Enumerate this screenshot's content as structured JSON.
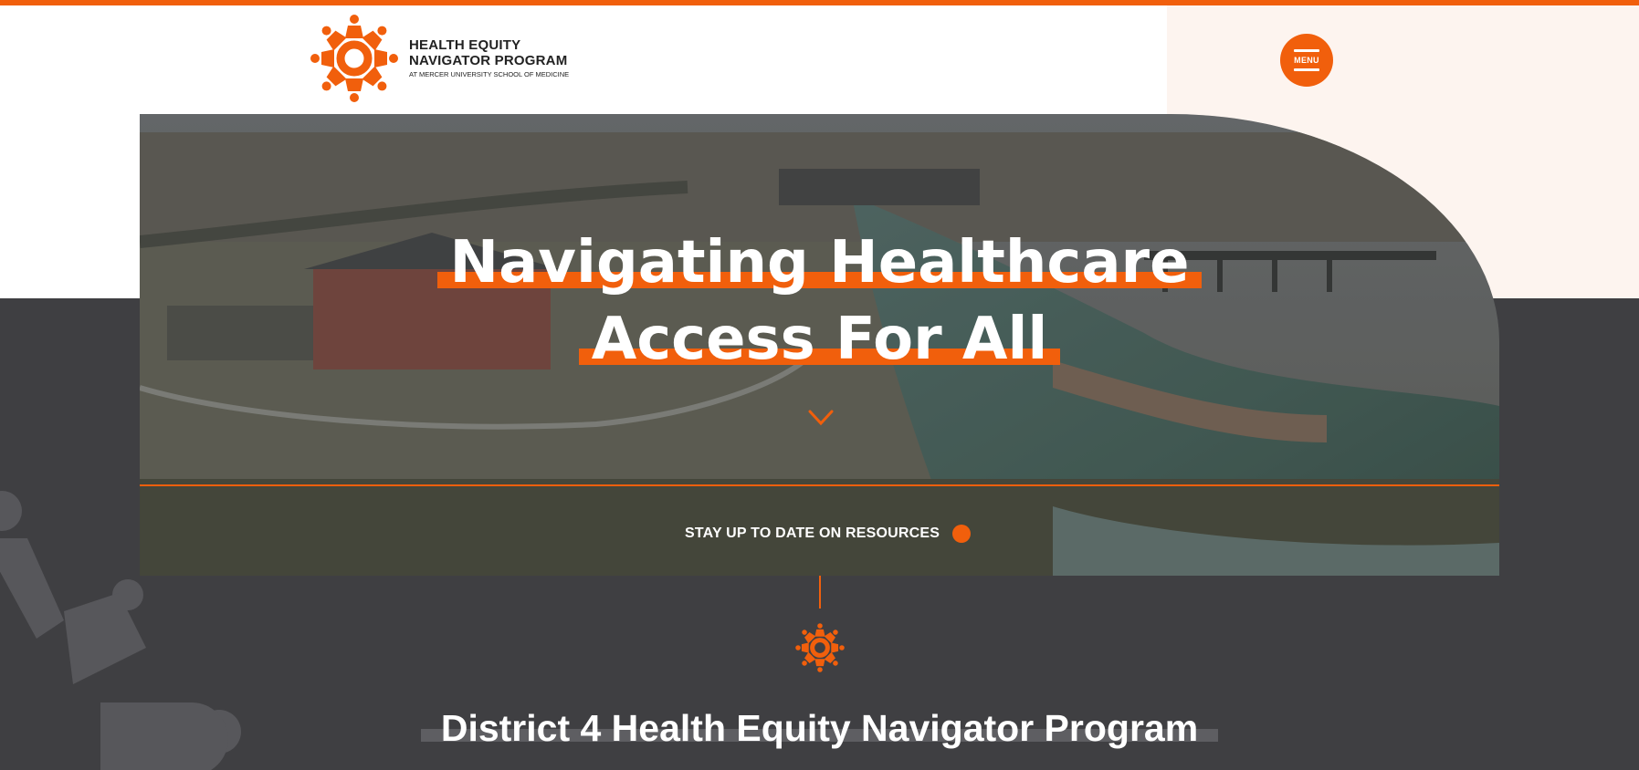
{
  "brand": {
    "name_line1": "HEALTH EQUITY",
    "name_line2": "NAVIGATOR PROGRAM",
    "tagline": "AT MERCER UNIVERSITY SCHOOL OF MEDICINE",
    "accent_color": "#f15f0c",
    "dark_color": "#3f3f42",
    "cream_color": "#fdf4ef"
  },
  "header": {
    "menu_label": "MENU"
  },
  "hero": {
    "title_line1": "Navigating Healthcare",
    "title_line2": "Access For All",
    "cta_label": "STAY UP TO DATE ON RESOURCES",
    "scroll_icon": "chevron-down-icon"
  },
  "section": {
    "heading": "District 4 Health Equity Navigator Program"
  }
}
